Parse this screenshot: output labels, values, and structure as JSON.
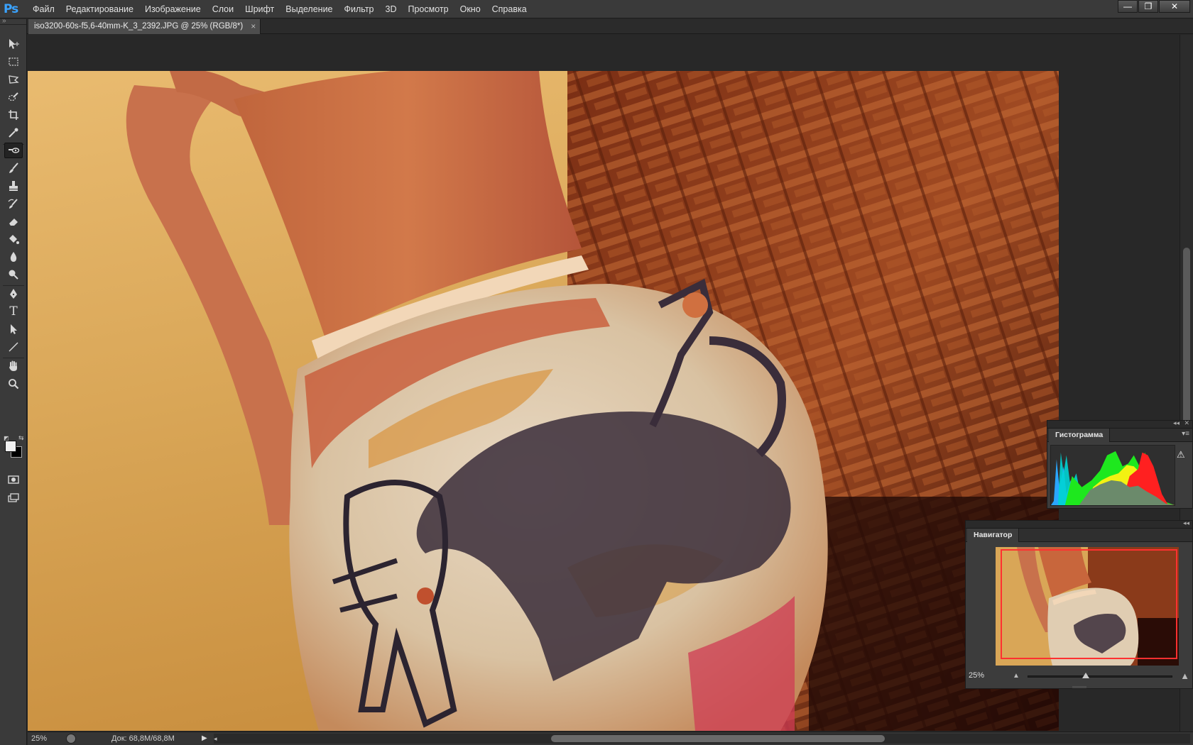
{
  "app": {
    "logo": "Ps",
    "menu": [
      "Файл",
      "Редактирование",
      "Изображение",
      "Слои",
      "Шрифт",
      "Выделение",
      "Фильтр",
      "3D",
      "Просмотр",
      "Окно",
      "Справка"
    ],
    "window_buttons": {
      "minimize": "—",
      "restore": "❐",
      "close": "✕"
    }
  },
  "document": {
    "tab_title": "iso3200-60s-f5,6-40mm-K_3_2392.JPG @ 25% (RGB/8*)",
    "tab_close": "×"
  },
  "tools": {
    "grip": "»",
    "items": [
      "move-tool",
      "marquee-tool",
      "lasso-tool",
      "quick-selection-tool",
      "crop-tool",
      "eyedropper-tool",
      "spot-healing-tool",
      "brush-tool",
      "clone-stamp-tool",
      "history-brush-tool",
      "eraser-tool",
      "paint-bucket-tool",
      "blur-tool",
      "dodge-tool",
      "pen-tool",
      "type-tool",
      "path-selection-tool",
      "line-tool",
      "hand-tool",
      "zoom-tool",
      "quick-mask-tool",
      "screen-mode-tool"
    ],
    "active": "spot-healing-tool",
    "type_glyph": "T",
    "default_colors_glyph": "◩",
    "swap_colors_glyph": "⇆",
    "foreground_color": "#f0f0f0",
    "background_color": "#000000"
  },
  "status": {
    "zoom": "25%",
    "doc_size": "Док: 68,8M/68,8M",
    "arrow": "▶",
    "scroll_left": "◂"
  },
  "panels": {
    "histogram": {
      "tab": "Гистограмма",
      "menu": "▾≡",
      "collapse": "◂◂",
      "close": "✕",
      "warning": "⚠"
    },
    "navigator": {
      "tab": "Навигатор",
      "collapse": "◂◂",
      "zoom": "25%",
      "zoom_out": "▲",
      "zoom_in": "▲",
      "slider_value": 0.4
    }
  },
  "colors": {
    "accent": "#3aa3ff",
    "navigator_view_box": "#ff3030"
  }
}
